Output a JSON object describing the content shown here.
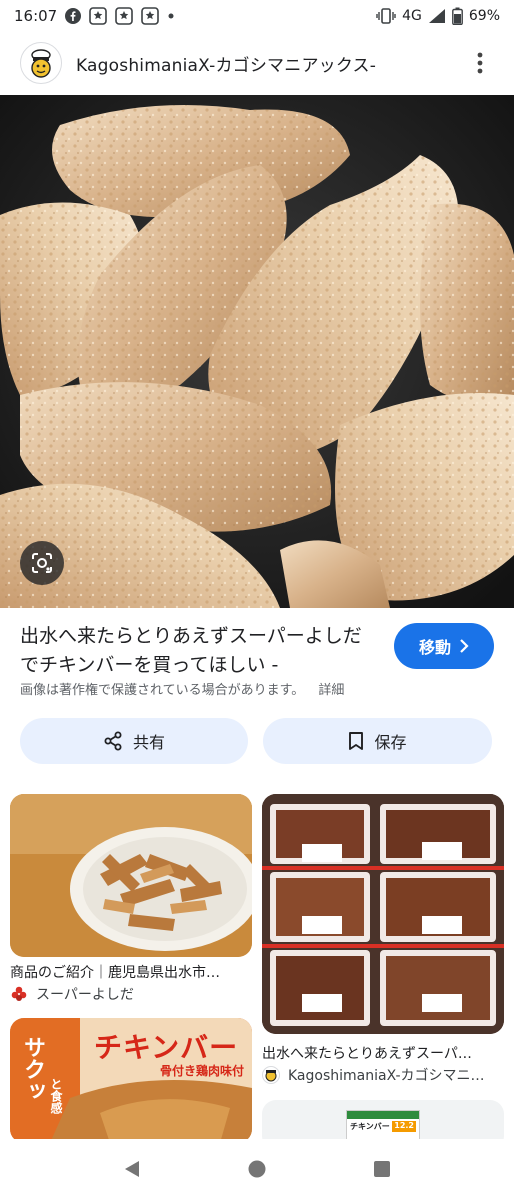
{
  "status_bar": {
    "time": "16:07",
    "network": "4G",
    "battery": "69%",
    "notification_icons": [
      "facebook-icon",
      "app-notification-icon",
      "app-notification-icon",
      "app-notification-icon",
      "dot-icon"
    ]
  },
  "source": {
    "site_name": "KagoshimaniaX-カゴシマニアックス-"
  },
  "result": {
    "title": "出水へ来たらとりあえずスーパーよしだでチキンバーを買ってほしい -",
    "visit_label": "移動",
    "copyright_notice": "画像は著作権で保護されている場合があります。",
    "details_label": "詳細"
  },
  "actions": {
    "share_label": "共有",
    "save_label": "保存"
  },
  "related": [
    {
      "title": "商品のご紹介｜鹿児島県出水市…",
      "source": "スーパーよしだ"
    },
    {
      "title": "出水へ来たらとりあえずスーパ…",
      "source": "KagoshimaniaX-カゴシマニ…"
    },
    {
      "banner_text": "チキンバー",
      "sub_text": "骨付き鶏肉味付",
      "side_text": "サクッ",
      "side_sub": "と食感"
    },
    {
      "label_text": "チキンバー",
      "badge_text": "12.2"
    }
  ],
  "colors": {
    "accent": "#1a73e8",
    "action_bg": "#e8f0fe"
  }
}
